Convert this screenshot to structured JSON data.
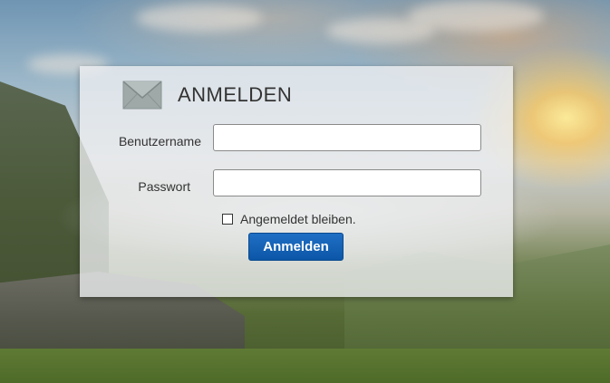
{
  "login": {
    "title": "ANMELDEN",
    "username_label": "Benutzername",
    "username_value": "",
    "password_label": "Passwort",
    "password_value": "",
    "remember_label": "Angemeldet bleiben.",
    "remember_checked": false,
    "submit_label": "Anmelden",
    "icon": "mail-icon"
  },
  "colors": {
    "button_bg": "#0c56a8",
    "panel_bg": "#eef0f2"
  }
}
